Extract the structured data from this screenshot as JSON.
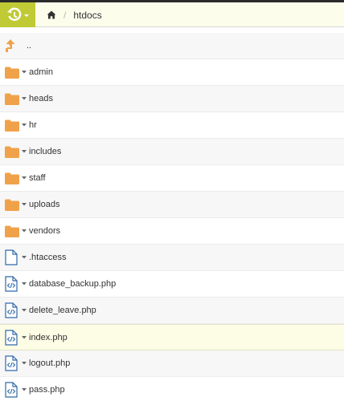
{
  "breadcrumb": {
    "home_icon": "home-icon",
    "current": "htdocs"
  },
  "colors": {
    "app_button": "#c0ca35",
    "folder": "#f0a24a",
    "file_outline": "#2f6aa8",
    "selected_row": "#fdfde6"
  },
  "items": [
    {
      "name": "..",
      "type": "up",
      "icon": "arrow-up-icon"
    },
    {
      "name": "admin",
      "type": "folder",
      "icon": "folder-icon"
    },
    {
      "name": "heads",
      "type": "folder",
      "icon": "folder-icon"
    },
    {
      "name": "hr",
      "type": "folder",
      "icon": "folder-icon"
    },
    {
      "name": "includes",
      "type": "folder",
      "icon": "folder-icon"
    },
    {
      "name": "staff",
      "type": "folder",
      "icon": "folder-icon"
    },
    {
      "name": "uploads",
      "type": "folder",
      "icon": "folder-icon"
    },
    {
      "name": "vendors",
      "type": "folder",
      "icon": "folder-icon"
    },
    {
      "name": ".htaccess",
      "type": "file",
      "icon": "file-icon"
    },
    {
      "name": "database_backup.php",
      "type": "code",
      "icon": "code-file-icon"
    },
    {
      "name": "delete_leave.php",
      "type": "code",
      "icon": "code-file-icon"
    },
    {
      "name": "index.php",
      "type": "code",
      "icon": "code-file-icon",
      "selected": true
    },
    {
      "name": "logout.php",
      "type": "code",
      "icon": "code-file-icon"
    },
    {
      "name": "pass.php",
      "type": "code",
      "icon": "code-file-icon"
    }
  ]
}
